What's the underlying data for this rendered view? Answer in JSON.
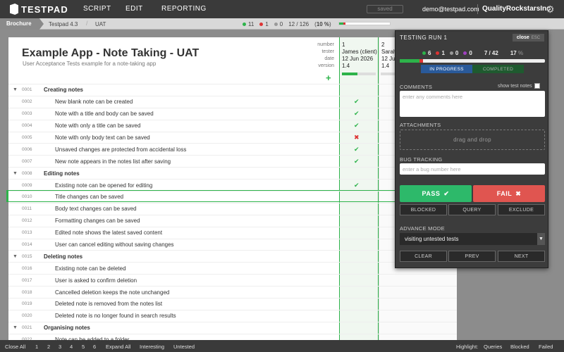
{
  "app": {
    "logo_text": "TESTPAD"
  },
  "nav": {
    "script": "SCRIPT",
    "edit": "EDIT",
    "reporting": "REPORTING"
  },
  "header": {
    "saved": "saved",
    "email": "demo@testpad.com",
    "company": "QualityRockstarsInc"
  },
  "breadcrumb": {
    "folder": "Brochure",
    "project": "Testpad 4.3",
    "script": "UAT"
  },
  "summary": {
    "pass": "11",
    "fail": "1",
    "blocked": "0",
    "progress": "12 / 126",
    "percent_open": "(",
    "percent": "10 %",
    "percent_close": ")"
  },
  "colors": {
    "pass": "#2db34a",
    "fail": "#dd3333",
    "accent": "#2a5a9a"
  },
  "script": {
    "title": "Example App - Note Taking - UAT",
    "subtitle": "User Acceptance Tests example for a note-taking app",
    "meta_labels": [
      "number",
      "tester",
      "date",
      "version"
    ],
    "add_icon": "plus-icon"
  },
  "runs": [
    {
      "number": "1",
      "tester": "James (client)",
      "date": "12 Jun 2026",
      "version": "1.4"
    },
    {
      "number": "2",
      "tester": "Sarah",
      "date": "12 Jun",
      "version": "1.4"
    }
  ],
  "rows": [
    {
      "num": "0001",
      "text": "Creating notes",
      "section": true,
      "result": ""
    },
    {
      "num": "0002",
      "text": "New blank note can be created",
      "section": false,
      "result": "pass"
    },
    {
      "num": "0003",
      "text": "Note with a title and body can be saved",
      "section": false,
      "result": "pass"
    },
    {
      "num": "0004",
      "text": "Note with only a title can be saved",
      "section": false,
      "result": "pass"
    },
    {
      "num": "0005",
      "text": "Note with only body text can be saved",
      "section": false,
      "result": "fail"
    },
    {
      "num": "0006",
      "text": "Unsaved changes are protected from accidental loss",
      "section": false,
      "result": "pass"
    },
    {
      "num": "0007",
      "text": "New note appears in the notes list after saving",
      "section": false,
      "result": "pass"
    },
    {
      "num": "0008",
      "text": "Editing notes",
      "section": true,
      "result": ""
    },
    {
      "num": "0009",
      "text": "Existing note can be opened for editing",
      "section": false,
      "result": "pass"
    },
    {
      "num": "0010",
      "text": "Title changes can be saved",
      "section": false,
      "result": ""
    },
    {
      "num": "0011",
      "text": "Body text changes can be saved",
      "section": false,
      "result": ""
    },
    {
      "num": "0012",
      "text": "Formatting changes can be saved",
      "section": false,
      "result": ""
    },
    {
      "num": "0013",
      "text": "Edited note shows the latest saved content",
      "section": false,
      "result": ""
    },
    {
      "num": "0014",
      "text": "User can cancel editing without saving changes",
      "section": false,
      "result": ""
    },
    {
      "num": "0015",
      "text": "Deleting notes",
      "section": true,
      "result": ""
    },
    {
      "num": "0016",
      "text": "Existing note can be deleted",
      "section": false,
      "result": ""
    },
    {
      "num": "0017",
      "text": "User is asked to confirm deletion",
      "section": false,
      "result": ""
    },
    {
      "num": "0018",
      "text": "Cancelled deletion keeps the note unchanged",
      "section": false,
      "result": ""
    },
    {
      "num": "0019",
      "text": "Deleted note is removed from the notes list",
      "section": false,
      "result": ""
    },
    {
      "num": "0020",
      "text": "Deleted note is no longer found in search results",
      "section": false,
      "result": ""
    },
    {
      "num": "0021",
      "text": "Organising notes",
      "section": true,
      "result": ""
    },
    {
      "num": "0022",
      "text": "Note can be added to a folder",
      "section": false,
      "result": ""
    }
  ],
  "bottom": {
    "close_all": "Close All",
    "levels": [
      "1",
      "2",
      "3",
      "4",
      "5",
      "6"
    ],
    "expand_all": "Expand All",
    "interesting": "Interesting",
    "untested": "Untested",
    "highlight": "Highlight:",
    "queries": "Queries",
    "blocked": "Blocked",
    "failed": "Failed"
  },
  "panel": {
    "title": "TESTING RUN 1",
    "close": "close",
    "esc": "ESC",
    "pass": "6",
    "fail": "1",
    "blocked": "0",
    "query": "0",
    "progress": "7 / 42",
    "percent": "17",
    "percent_unit": "%",
    "tab_in_progress": "IN PROGRESS",
    "tab_completed": "COMPLETED",
    "comments_label": "COMMENTS",
    "show_notes": "show test notes",
    "comments_placeholder": "enter any comments here",
    "attachments_label": "ATTACHMENTS",
    "drag_drop": "drag and drop",
    "bug_label": "BUG TRACKING",
    "bug_placeholder": "enter a bug number here",
    "pass_btn": "PASS",
    "fail_btn": "FAIL",
    "blocked_btn": "BLOCKED",
    "query_btn": "QUERY",
    "exclude_btn": "EXCLUDE",
    "advance_label": "ADVANCE MODE",
    "advance_value": "visiting untested tests",
    "clear_btn": "CLEAR",
    "prev_btn": "PREV",
    "next_btn": "NEXT"
  }
}
